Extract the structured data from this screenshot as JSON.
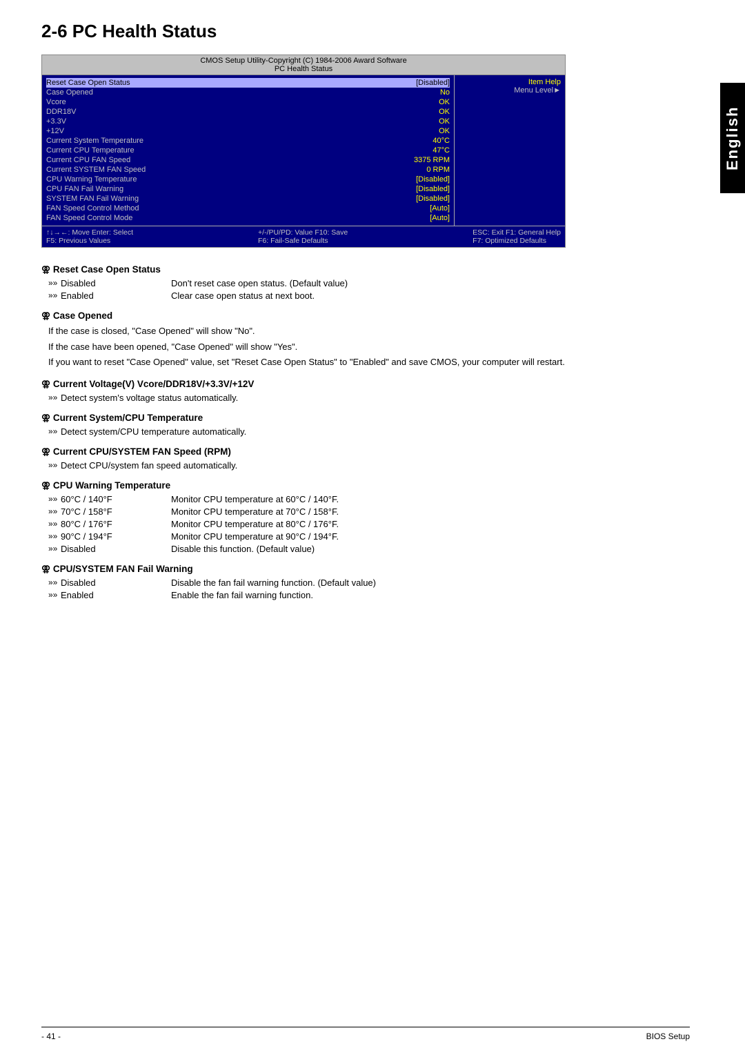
{
  "page": {
    "title": "2-6   PC Health Status",
    "english_label": "English",
    "footer_page": "- 41 -",
    "footer_label": "BIOS Setup"
  },
  "bios": {
    "header_line1": "CMOS Setup Utility-Copyright (C) 1984-2006 Award Software",
    "header_line2": "PC Health Status",
    "item_help_title": "Item Help",
    "item_help_menu": "Menu Level►",
    "rows": [
      {
        "label": "Reset Case Open Status",
        "value": "[Disabled]",
        "highlight": true
      },
      {
        "label": "Case Opened",
        "value": "No",
        "highlight": false
      },
      {
        "label": "Vcore",
        "value": "OK",
        "highlight": false
      },
      {
        "label": "DDR18V",
        "value": "OK",
        "highlight": false
      },
      {
        "label": "+3.3V",
        "value": "OK",
        "highlight": false
      },
      {
        "label": "+12V",
        "value": "OK",
        "highlight": false
      },
      {
        "label": "Current System Temperature",
        "value": "40°C",
        "highlight": false
      },
      {
        "label": "Current CPU Temperature",
        "value": "47°C",
        "highlight": false
      },
      {
        "label": "Current CPU FAN Speed",
        "value": "3375 RPM",
        "highlight": false
      },
      {
        "label": "Current SYSTEM FAN Speed",
        "value": "0    RPM",
        "highlight": false
      },
      {
        "label": "CPU Warning Temperature",
        "value": "[Disabled]",
        "highlight": false
      },
      {
        "label": "CPU FAN Fail Warning",
        "value": "[Disabled]",
        "highlight": false
      },
      {
        "label": "SYSTEM FAN Fail Warning",
        "value": "[Disabled]",
        "highlight": false
      },
      {
        "label": "FAN Speed Control Method",
        "value": "[Auto]",
        "highlight": false
      },
      {
        "label": "FAN Speed Control Mode",
        "value": "[Auto]",
        "highlight": false
      }
    ],
    "footer_left1": "↑↓→←: Move      Enter: Select",
    "footer_left2": "F5: Previous Values",
    "footer_mid1": "+/-/PU/PD: Value      F10: Save",
    "footer_mid2": "F6: Fail-Safe Defaults",
    "footer_right1": "ESC: Exit      F1: General Help",
    "footer_right2": "F7: Optimized Defaults"
  },
  "sections": [
    {
      "id": "reset-case-open-status",
      "title": "Reset Case Open Status",
      "items": [
        {
          "key": "Disabled",
          "desc": "Don't reset case open status. (Default value)"
        },
        {
          "key": "Enabled",
          "desc": "Clear case open status at next boot."
        }
      ],
      "plain_texts": []
    },
    {
      "id": "case-opened",
      "title": "Case Opened",
      "items": [],
      "plain_texts": [
        "If the case is closed, \"Case Opened\" will show \"No\".",
        "If the case have been opened, \"Case Opened\" will show \"Yes\".",
        "If you want to reset \"Case Opened\" value, set \"Reset Case Open Status\" to \"Enabled\" and save CMOS, your computer will restart."
      ]
    },
    {
      "id": "current-voltage",
      "title": "Current Voltage(V) Vcore/DDR18V/+3.3V/+12V",
      "items": [
        {
          "key": "Detect system's voltage status automatically.",
          "desc": ""
        }
      ],
      "plain_texts": []
    },
    {
      "id": "current-system-cpu-temp",
      "title": "Current System/CPU Temperature",
      "items": [
        {
          "key": "Detect system/CPU temperature automatically.",
          "desc": ""
        }
      ],
      "plain_texts": []
    },
    {
      "id": "current-fan-speed",
      "title": "Current CPU/SYSTEM FAN Speed (RPM)",
      "items": [
        {
          "key": "Detect CPU/system fan speed automatically.",
          "desc": ""
        }
      ],
      "plain_texts": []
    },
    {
      "id": "cpu-warning-temp",
      "title": "CPU Warning Temperature",
      "items": [
        {
          "key": "60°C / 140°F",
          "desc": "Monitor CPU temperature at 60°C / 140°F."
        },
        {
          "key": "70°C / 158°F",
          "desc": "Monitor CPU temperature at 70°C / 158°F."
        },
        {
          "key": "80°C / 176°F",
          "desc": "Monitor CPU temperature at 80°C / 176°F."
        },
        {
          "key": "90°C / 194°F",
          "desc": "Monitor CPU temperature at 90°C / 194°F."
        },
        {
          "key": "Disabled",
          "desc": "Disable this function. (Default value)"
        }
      ],
      "plain_texts": []
    },
    {
      "id": "cpu-system-fan-fail",
      "title": "CPU/SYSTEM FAN Fail Warning",
      "items": [
        {
          "key": "Disabled",
          "desc": "Disable the fan fail warning function. (Default value)"
        },
        {
          "key": "Enabled",
          "desc": "Enable the fan fail warning function."
        }
      ],
      "plain_texts": []
    }
  ]
}
